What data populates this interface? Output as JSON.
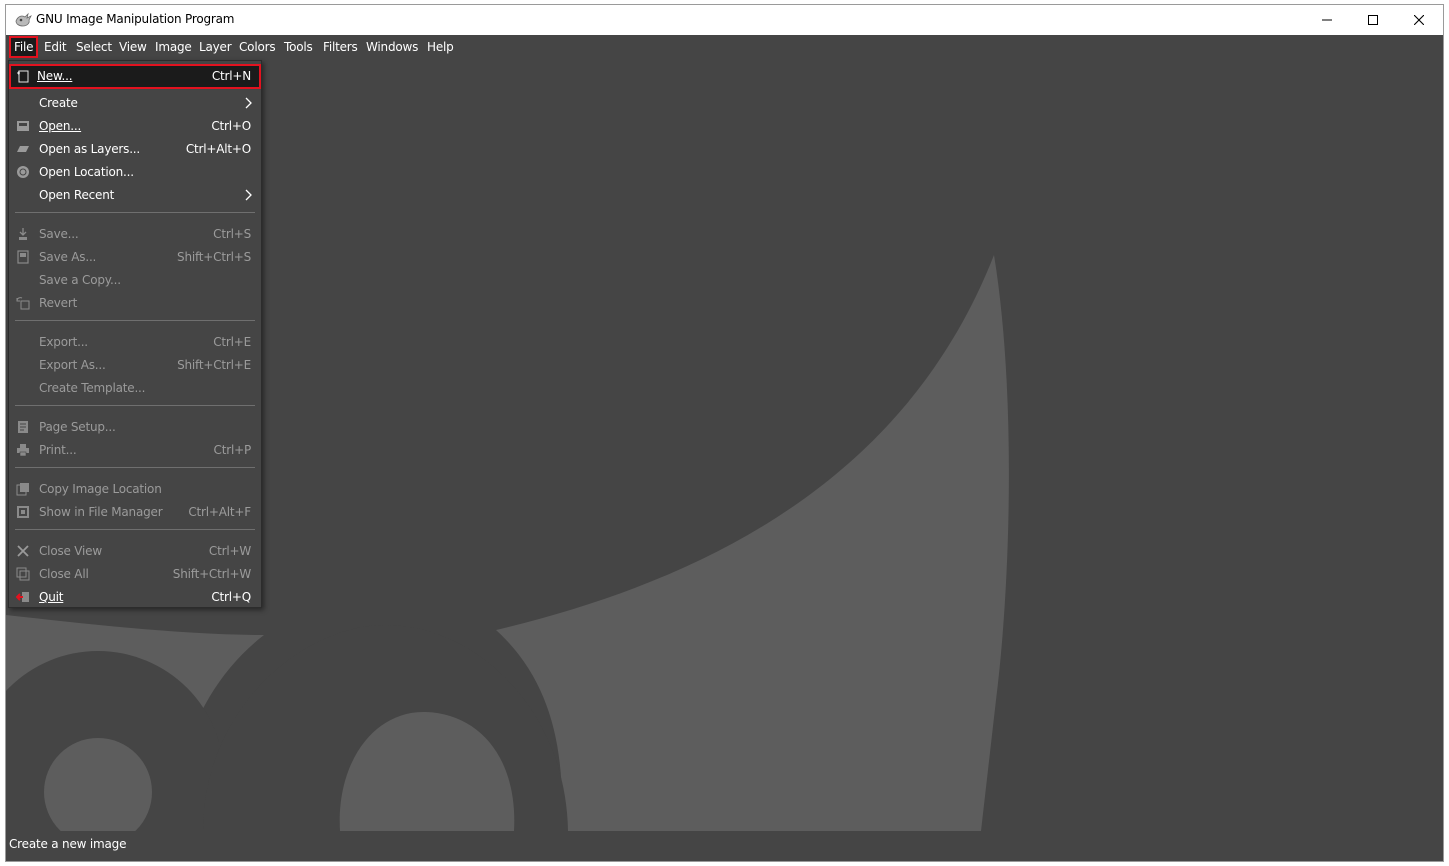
{
  "window": {
    "title": "GNU Image Manipulation Program",
    "controls": [
      "minimize-icon",
      "maximize-icon",
      "close-icon"
    ]
  },
  "menubar": {
    "items": [
      {
        "label": "File",
        "active": true
      },
      {
        "label": "Edit"
      },
      {
        "label": "Select"
      },
      {
        "label": "View"
      },
      {
        "label": "Image"
      },
      {
        "label": "Layer"
      },
      {
        "label": "Colors"
      },
      {
        "label": "Tools"
      },
      {
        "label": "Filters"
      },
      {
        "label": "Windows"
      },
      {
        "label": "Help"
      }
    ]
  },
  "file_menu": {
    "items": [
      {
        "label": "New...",
        "accel": "Ctrl+N",
        "icon": "new-image-icon",
        "enabled": true,
        "highlight": true
      },
      {
        "label": "Create",
        "accel": "",
        "submenu": true,
        "enabled": true
      },
      {
        "label": "Open...",
        "accel": "Ctrl+O",
        "icon": "open-icon",
        "enabled": true
      },
      {
        "label": "Open as Layers...",
        "accel": "Ctrl+Alt+O",
        "icon": "open-layers-icon",
        "enabled": true
      },
      {
        "label": "Open Location...",
        "accel": "",
        "icon": "globe-icon",
        "enabled": true
      },
      {
        "label": "Open Recent",
        "accel": "",
        "submenu": true,
        "enabled": true
      },
      {
        "label": "Save...",
        "accel": "Ctrl+S",
        "icon": "save-icon",
        "enabled": false
      },
      {
        "label": "Save As...",
        "accel": "Shift+Ctrl+S",
        "icon": "save-as-icon",
        "enabled": false
      },
      {
        "label": "Save a Copy...",
        "accel": "",
        "enabled": false
      },
      {
        "label": "Revert",
        "accel": "",
        "icon": "revert-icon",
        "enabled": false
      },
      {
        "label": "Export...",
        "accel": "Ctrl+E",
        "enabled": false
      },
      {
        "label": "Export As...",
        "accel": "Shift+Ctrl+E",
        "enabled": false
      },
      {
        "label": "Create Template...",
        "accel": "",
        "enabled": false
      },
      {
        "label": "Page Setup...",
        "accel": "",
        "icon": "page-setup-icon",
        "enabled": false
      },
      {
        "label": "Print...",
        "accel": "Ctrl+P",
        "icon": "print-icon",
        "enabled": false
      },
      {
        "label": "Copy Image Location",
        "accel": "",
        "icon": "copy-location-icon",
        "enabled": false
      },
      {
        "label": "Show in File Manager",
        "accel": "Ctrl+Alt+F",
        "icon": "file-manager-icon",
        "enabled": false
      },
      {
        "label": "Close View",
        "accel": "Ctrl+W",
        "icon": "close-view-icon",
        "enabled": false
      },
      {
        "label": "Close All",
        "accel": "Shift+Ctrl+W",
        "icon": "close-all-icon",
        "enabled": false
      },
      {
        "label": "Quit",
        "accel": "Ctrl+Q",
        "icon": "quit-icon",
        "enabled": true
      }
    ]
  },
  "status": {
    "text": "Create a new image"
  },
  "colors": {
    "background": "#454545",
    "wilber_shape": "#5e5e5e",
    "highlight_border": "#e3121f",
    "menu_highlight": "#1b1b1b",
    "disabled_text": "#9b9b9b"
  }
}
